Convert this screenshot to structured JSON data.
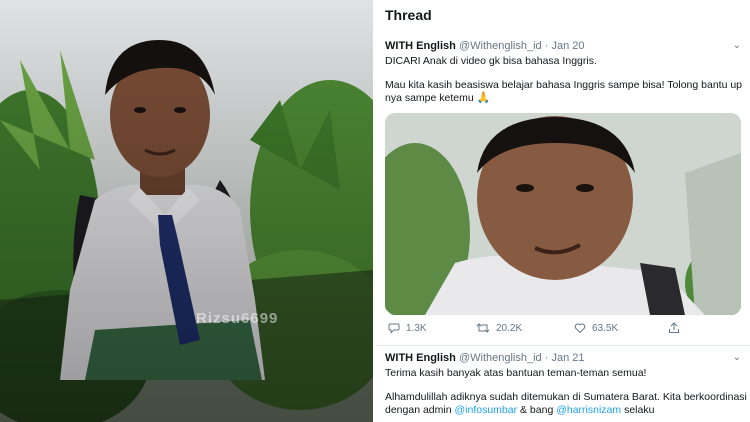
{
  "photo_left": {
    "watermark": "Rizsu6699"
  },
  "thread": {
    "title": "Thread",
    "tweets": [
      {
        "name": "WITH English",
        "handle": "@Withenglish_id",
        "date": "· Jan 20",
        "line1": "DICARI Anak di video gk bisa bahasa Inggris.",
        "line2": "Mau kita kasih beasiswa belajar bahasa Inggris sampe bisa! Tolong bantu up nya sampe ketemu",
        "emoji": "🙏",
        "replies": "1.3K",
        "retweets": "20.2K",
        "likes": "63.5K"
      },
      {
        "name": "WITH English",
        "handle": "@Withenglish_id",
        "date": "· Jan 21",
        "line1": "Terima kasih banyak atas bantuan teman-teman semua!",
        "line2a": "Alhamdulillah adiknya sudah ditemukan di Sumatera Barat. Kita berkoordinasi dengan admin ",
        "mention1": "@infosumbar",
        "line2b": " & bang ",
        "mention2": "@harrisnizam",
        "line2c": " selaku"
      }
    ]
  },
  "colors": {
    "accent": "#1da1f2",
    "muted": "#657786",
    "text": "#14171a"
  },
  "icons": [
    "reply-icon",
    "retweet-icon",
    "like-icon",
    "share-icon",
    "chevron-down-icon",
    "pray-emoji"
  ]
}
